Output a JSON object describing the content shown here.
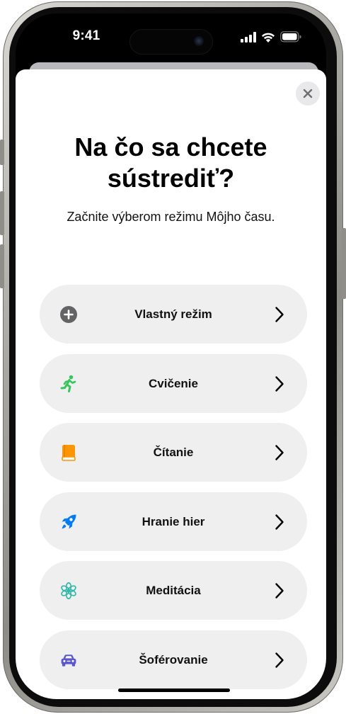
{
  "status_bar": {
    "time": "9:41"
  },
  "sheet": {
    "title_line1": "Na čo sa chcete",
    "title_line2": "sústrediť?",
    "subtitle": "Začnite výberom režimu Môjho času."
  },
  "modes": [
    {
      "label": "Vlastný režim",
      "icon": "plus-circle-icon",
      "color": "#6e6e73"
    },
    {
      "label": "Cvičenie",
      "icon": "running-figure-icon",
      "color": "#34c759"
    },
    {
      "label": "Čítanie",
      "icon": "book-icon",
      "color": "#ff9500"
    },
    {
      "label": "Hranie hier",
      "icon": "rocket-icon",
      "color": "#007aff"
    },
    {
      "label": "Meditácia",
      "icon": "flower-icon",
      "color": "#30b8a8"
    },
    {
      "label": "Šoférovanie",
      "icon": "car-icon",
      "color": "#5856d6"
    }
  ]
}
